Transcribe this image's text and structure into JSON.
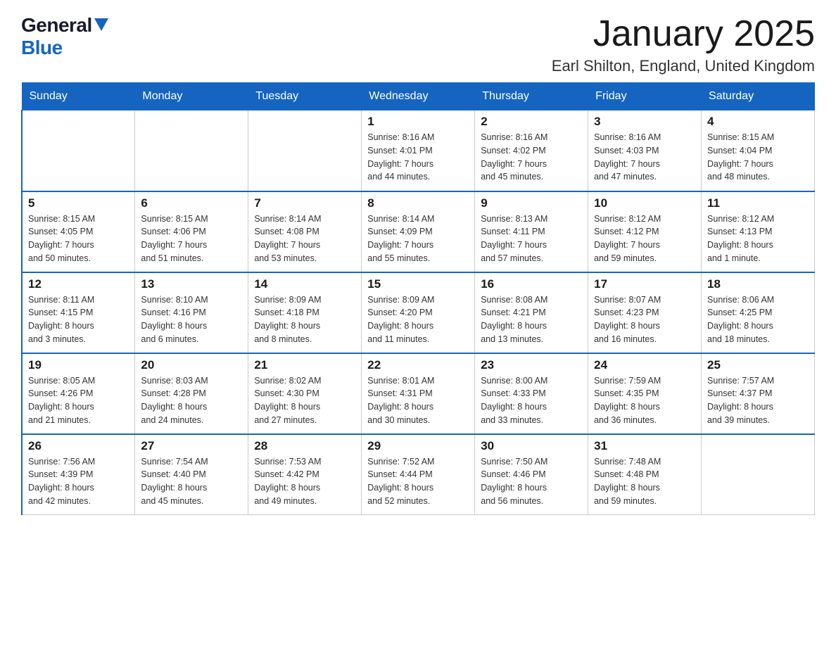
{
  "header": {
    "logo_general": "General",
    "logo_blue": "Blue",
    "month_title": "January 2025",
    "location": "Earl Shilton, England, United Kingdom"
  },
  "days_of_week": [
    "Sunday",
    "Monday",
    "Tuesday",
    "Wednesday",
    "Thursday",
    "Friday",
    "Saturday"
  ],
  "weeks": [
    [
      {
        "day": "",
        "info": ""
      },
      {
        "day": "",
        "info": ""
      },
      {
        "day": "",
        "info": ""
      },
      {
        "day": "1",
        "info": "Sunrise: 8:16 AM\nSunset: 4:01 PM\nDaylight: 7 hours\nand 44 minutes."
      },
      {
        "day": "2",
        "info": "Sunrise: 8:16 AM\nSunset: 4:02 PM\nDaylight: 7 hours\nand 45 minutes."
      },
      {
        "day": "3",
        "info": "Sunrise: 8:16 AM\nSunset: 4:03 PM\nDaylight: 7 hours\nand 47 minutes."
      },
      {
        "day": "4",
        "info": "Sunrise: 8:15 AM\nSunset: 4:04 PM\nDaylight: 7 hours\nand 48 minutes."
      }
    ],
    [
      {
        "day": "5",
        "info": "Sunrise: 8:15 AM\nSunset: 4:05 PM\nDaylight: 7 hours\nand 50 minutes."
      },
      {
        "day": "6",
        "info": "Sunrise: 8:15 AM\nSunset: 4:06 PM\nDaylight: 7 hours\nand 51 minutes."
      },
      {
        "day": "7",
        "info": "Sunrise: 8:14 AM\nSunset: 4:08 PM\nDaylight: 7 hours\nand 53 minutes."
      },
      {
        "day": "8",
        "info": "Sunrise: 8:14 AM\nSunset: 4:09 PM\nDaylight: 7 hours\nand 55 minutes."
      },
      {
        "day": "9",
        "info": "Sunrise: 8:13 AM\nSunset: 4:11 PM\nDaylight: 7 hours\nand 57 minutes."
      },
      {
        "day": "10",
        "info": "Sunrise: 8:12 AM\nSunset: 4:12 PM\nDaylight: 7 hours\nand 59 minutes."
      },
      {
        "day": "11",
        "info": "Sunrise: 8:12 AM\nSunset: 4:13 PM\nDaylight: 8 hours\nand 1 minute."
      }
    ],
    [
      {
        "day": "12",
        "info": "Sunrise: 8:11 AM\nSunset: 4:15 PM\nDaylight: 8 hours\nand 3 minutes."
      },
      {
        "day": "13",
        "info": "Sunrise: 8:10 AM\nSunset: 4:16 PM\nDaylight: 8 hours\nand 6 minutes."
      },
      {
        "day": "14",
        "info": "Sunrise: 8:09 AM\nSunset: 4:18 PM\nDaylight: 8 hours\nand 8 minutes."
      },
      {
        "day": "15",
        "info": "Sunrise: 8:09 AM\nSunset: 4:20 PM\nDaylight: 8 hours\nand 11 minutes."
      },
      {
        "day": "16",
        "info": "Sunrise: 8:08 AM\nSunset: 4:21 PM\nDaylight: 8 hours\nand 13 minutes."
      },
      {
        "day": "17",
        "info": "Sunrise: 8:07 AM\nSunset: 4:23 PM\nDaylight: 8 hours\nand 16 minutes."
      },
      {
        "day": "18",
        "info": "Sunrise: 8:06 AM\nSunset: 4:25 PM\nDaylight: 8 hours\nand 18 minutes."
      }
    ],
    [
      {
        "day": "19",
        "info": "Sunrise: 8:05 AM\nSunset: 4:26 PM\nDaylight: 8 hours\nand 21 minutes."
      },
      {
        "day": "20",
        "info": "Sunrise: 8:03 AM\nSunset: 4:28 PM\nDaylight: 8 hours\nand 24 minutes."
      },
      {
        "day": "21",
        "info": "Sunrise: 8:02 AM\nSunset: 4:30 PM\nDaylight: 8 hours\nand 27 minutes."
      },
      {
        "day": "22",
        "info": "Sunrise: 8:01 AM\nSunset: 4:31 PM\nDaylight: 8 hours\nand 30 minutes."
      },
      {
        "day": "23",
        "info": "Sunrise: 8:00 AM\nSunset: 4:33 PM\nDaylight: 8 hours\nand 33 minutes."
      },
      {
        "day": "24",
        "info": "Sunrise: 7:59 AM\nSunset: 4:35 PM\nDaylight: 8 hours\nand 36 minutes."
      },
      {
        "day": "25",
        "info": "Sunrise: 7:57 AM\nSunset: 4:37 PM\nDaylight: 8 hours\nand 39 minutes."
      }
    ],
    [
      {
        "day": "26",
        "info": "Sunrise: 7:56 AM\nSunset: 4:39 PM\nDaylight: 8 hours\nand 42 minutes."
      },
      {
        "day": "27",
        "info": "Sunrise: 7:54 AM\nSunset: 4:40 PM\nDaylight: 8 hours\nand 45 minutes."
      },
      {
        "day": "28",
        "info": "Sunrise: 7:53 AM\nSunset: 4:42 PM\nDaylight: 8 hours\nand 49 minutes."
      },
      {
        "day": "29",
        "info": "Sunrise: 7:52 AM\nSunset: 4:44 PM\nDaylight: 8 hours\nand 52 minutes."
      },
      {
        "day": "30",
        "info": "Sunrise: 7:50 AM\nSunset: 4:46 PM\nDaylight: 8 hours\nand 56 minutes."
      },
      {
        "day": "31",
        "info": "Sunrise: 7:48 AM\nSunset: 4:48 PM\nDaylight: 8 hours\nand 59 minutes."
      },
      {
        "day": "",
        "info": ""
      }
    ]
  ]
}
